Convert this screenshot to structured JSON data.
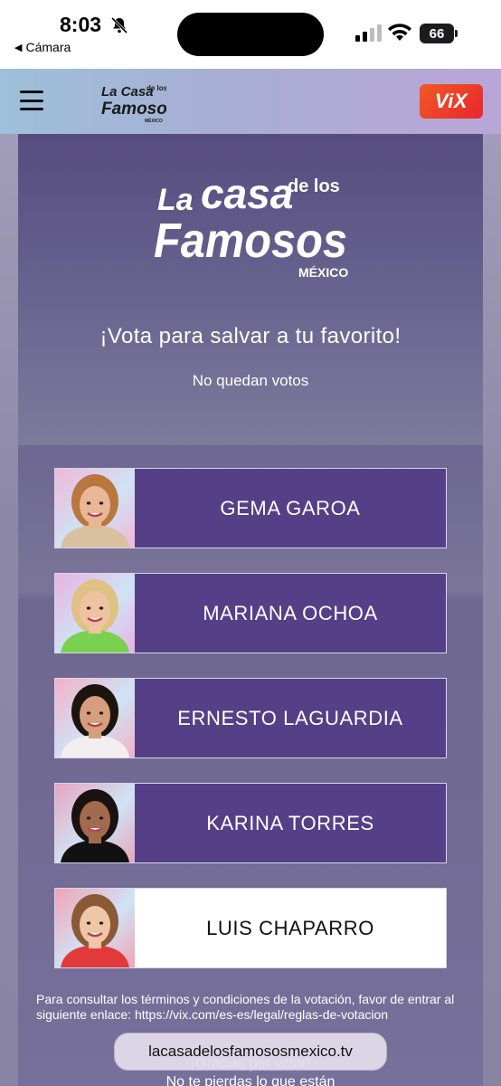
{
  "status_bar": {
    "time": "8:03",
    "back_app": "Cámara",
    "battery": "66"
  },
  "header": {
    "logo_text": "La Casa de los Famosos México",
    "vix_label": "ViX"
  },
  "main": {
    "logo_text": "La Casa de los Famosos México",
    "heading": "¡Vota para salvar a tu favorito!",
    "votes_status": "No quedan votos"
  },
  "contestants": [
    {
      "name": "GEMA GAROA",
      "selected": false,
      "bg": "#f0b8d8",
      "skin": "#e9b795",
      "hair": "#b9773f",
      "shirt": "#d9c0a0"
    },
    {
      "name": "MARIANA OCHOA",
      "selected": false,
      "bg": "#e9b2e4",
      "skin": "#efc3a2",
      "hair": "#e0c184",
      "shirt": "#7ad14f"
    },
    {
      "name": "ERNESTO LAGUARDIA",
      "selected": false,
      "bg": "#f4b0c7",
      "skin": "#d79e7d",
      "hair": "#1d1410",
      "shirt": "#f3eff0"
    },
    {
      "name": "KARINA TORRES",
      "selected": false,
      "bg": "#e6a6bf",
      "skin": "#a26a4e",
      "hair": "#1a1210",
      "shirt": "#111111"
    },
    {
      "name": "LUIS CHAPARRO",
      "selected": true,
      "bg": "#f2a3b6",
      "skin": "#f0c6a9",
      "hair": "#8a5a36",
      "shirt": "#e23a3a"
    }
  ],
  "footer": {
    "terms": "Para consultar los términos y condiciones de la votación, favor de entrar al siguiente enlace: https://vix.com/es-es/legal/reglas-de-votacion",
    "hidden_line_1": "¡Gracias por votar!",
    "hidden_line_2": "No te pierdas lo que están",
    "url": "lacasadelosfamososmexico.tv"
  }
}
